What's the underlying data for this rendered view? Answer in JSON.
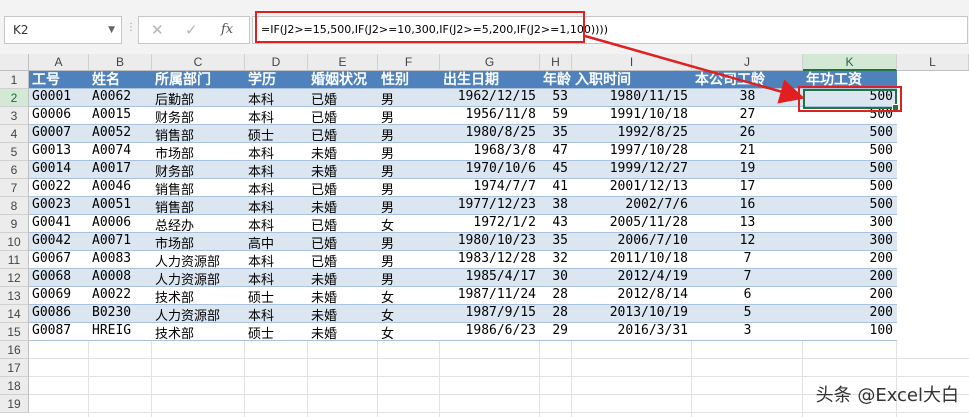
{
  "formula_bar": {
    "name_box": "K2",
    "cancel_icon": "✕",
    "ok_icon": "✓",
    "fx_label": "fx",
    "formula": "=IF(J2>=15,500,IF(J2>=10,300,IF(J2>=5,200,IF(J2>=1,100))))"
  },
  "columns": [
    "A",
    "B",
    "C",
    "D",
    "E",
    "F",
    "G",
    "H",
    "I",
    "J",
    "K",
    "L"
  ],
  "selected_column": "K",
  "selected_row": "2",
  "row_numbers": [
    "1",
    "2",
    "3",
    "4",
    "5",
    "6",
    "7",
    "8",
    "9",
    "10",
    "11",
    "12",
    "13",
    "14",
    "15",
    "16",
    "17",
    "18",
    "19"
  ],
  "headers": [
    "工号",
    "姓名",
    "所属部门",
    "学历",
    "婚姻状况",
    "性别",
    "出生日期",
    "年龄",
    "入职时间",
    "本公司工龄",
    "年功工资"
  ],
  "rows": [
    [
      "G0001",
      "A0062",
      "后勤部",
      "本科",
      "已婚",
      "男",
      "1962/12/15",
      "53",
      "1980/11/15",
      "38",
      "500"
    ],
    [
      "G0006",
      "A0015",
      "财务部",
      "本科",
      "已婚",
      "男",
      "1956/11/8",
      "59",
      "1991/10/18",
      "27",
      "500"
    ],
    [
      "G0007",
      "A0052",
      "销售部",
      "硕士",
      "已婚",
      "男",
      "1980/8/25",
      "35",
      "1992/8/25",
      "26",
      "500"
    ],
    [
      "G0013",
      "A0074",
      "市场部",
      "本科",
      "未婚",
      "男",
      "1968/3/8",
      "47",
      "1997/10/28",
      "21",
      "500"
    ],
    [
      "G0014",
      "A0017",
      "财务部",
      "本科",
      "未婚",
      "男",
      "1970/10/6",
      "45",
      "1999/12/27",
      "19",
      "500"
    ],
    [
      "G0022",
      "A0046",
      "销售部",
      "本科",
      "已婚",
      "男",
      "1974/7/7",
      "41",
      "2001/12/13",
      "17",
      "500"
    ],
    [
      "G0023",
      "A0051",
      "销售部",
      "本科",
      "未婚",
      "男",
      "1977/12/23",
      "38",
      "2002/7/6",
      "16",
      "500"
    ],
    [
      "G0041",
      "A0006",
      "总经办",
      "本科",
      "已婚",
      "女",
      "1972/1/2",
      "43",
      "2005/11/28",
      "13",
      "300"
    ],
    [
      "G0042",
      "A0071",
      "市场部",
      "高中",
      "已婚",
      "男",
      "1980/10/23",
      "35",
      "2006/7/10",
      "12",
      "300"
    ],
    [
      "G0067",
      "A0083",
      "人力资源部",
      "本科",
      "已婚",
      "男",
      "1983/12/28",
      "32",
      "2011/10/18",
      "7",
      "200"
    ],
    [
      "G0068",
      "A0008",
      "人力资源部",
      "本科",
      "未婚",
      "男",
      "1985/4/17",
      "30",
      "2012/4/19",
      "7",
      "200"
    ],
    [
      "G0069",
      "A0022",
      "技术部",
      "硕士",
      "未婚",
      "女",
      "1987/11/24",
      "28",
      "2012/8/14",
      "6",
      "200"
    ],
    [
      "G0086",
      "B0230",
      "人力资源部",
      "本科",
      "未婚",
      "女",
      "1987/9/15",
      "28",
      "2013/10/19",
      "5",
      "200"
    ],
    [
      "G0087",
      "HREIG",
      "技术部",
      "硕士",
      "未婚",
      "女",
      "1986/6/23",
      "29",
      "2016/3/31",
      "3",
      "100"
    ]
  ],
  "watermark": "头条 @Excel大白",
  "colors": {
    "header_bg": "#4f81bd",
    "band_bg": "#dce6f1",
    "accent": "#217346",
    "annotation": "#e02020"
  }
}
